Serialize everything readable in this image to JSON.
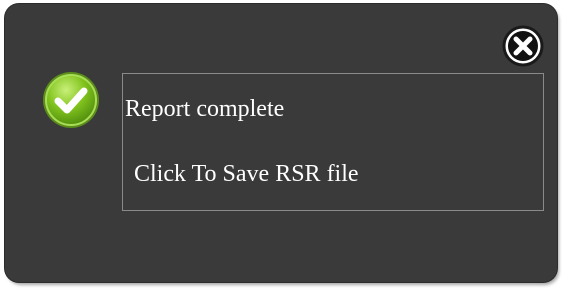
{
  "notification": {
    "title": "Report complete",
    "action_label": "Click To Save RSR file",
    "status_icon": "check-circle-icon",
    "close_icon": "close-icon",
    "colors": {
      "background": "#3a3a3a",
      "text": "#ffffff",
      "success_green": "#7cc11b",
      "border": "#8a8a8a"
    }
  }
}
